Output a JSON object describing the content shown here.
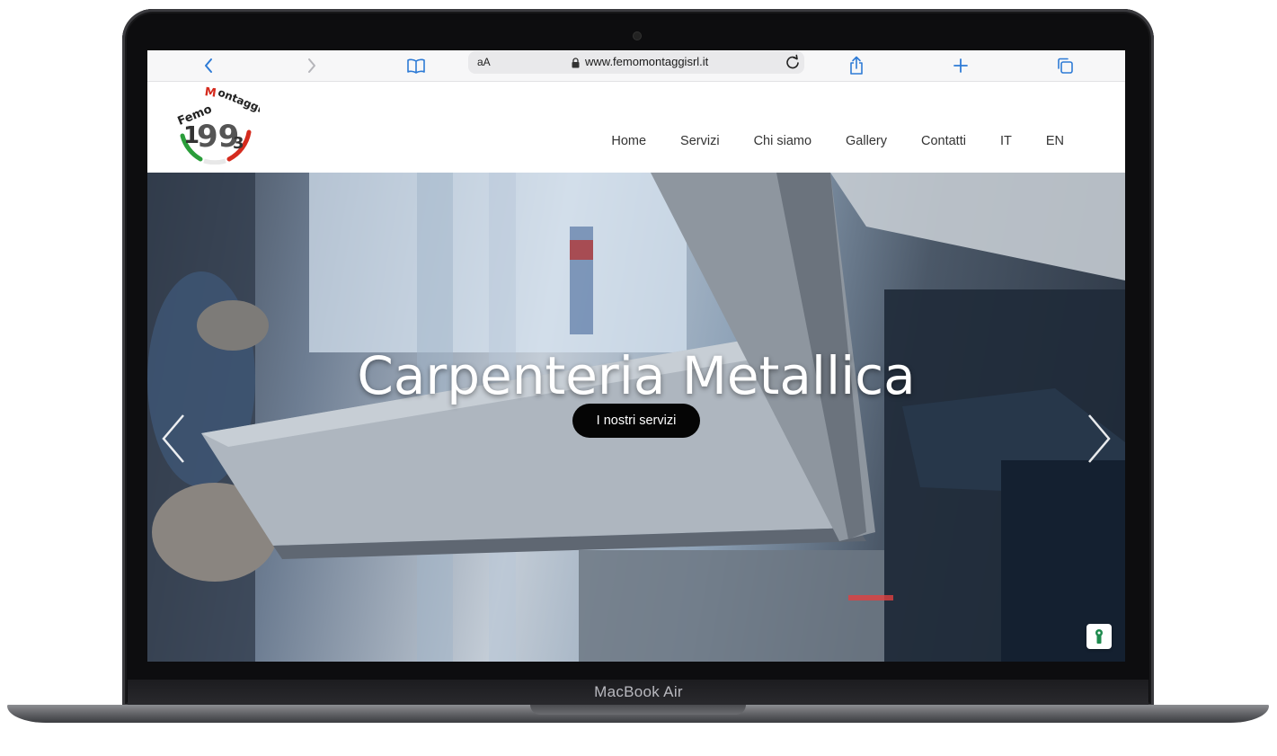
{
  "browser": {
    "text_size_label": "aA",
    "url": "www.femomontaggisrl.it"
  },
  "site": {
    "logo_text": "Femo Montaggi",
    "logo_year": "1993"
  },
  "nav": {
    "items": [
      {
        "label": "Home"
      },
      {
        "label": "Servizi"
      },
      {
        "label": "Chi siamo"
      },
      {
        "label": "Gallery"
      },
      {
        "label": "Contatti"
      },
      {
        "label": "IT"
      },
      {
        "label": "EN"
      }
    ]
  },
  "hero": {
    "title": "Carpenteria Metallica",
    "button_label": "I nostri servizi"
  },
  "device": {
    "model": "MacBook Air"
  },
  "colors": {
    "accent_blue": "#2e7bd6",
    "button_bg": "#050505",
    "logo_red": "#d52b1e",
    "logo_green": "#2a9d3a"
  }
}
